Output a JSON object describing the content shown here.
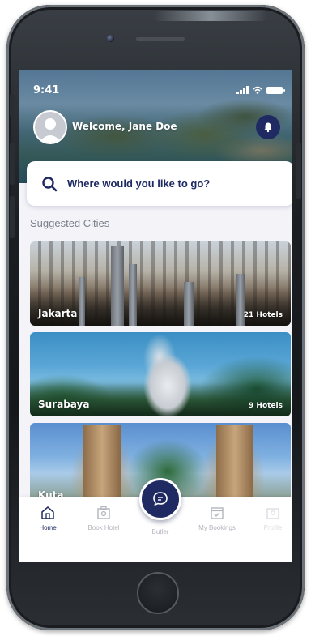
{
  "status_bar": {
    "time": "9:41"
  },
  "header": {
    "welcome_text": "Welcome, Jane Doe",
    "avatar_icon": "user-avatar-icon",
    "bell_icon": "bell-icon"
  },
  "search": {
    "placeholder": "Where would you like to go?"
  },
  "suggested": {
    "title": "Suggested Cities",
    "cities": [
      {
        "name": "Jakarta",
        "hotels": "21 Hotels"
      },
      {
        "name": "Surabaya",
        "hotels": "9 Hotels"
      },
      {
        "name": "Kuta",
        "hotels": ""
      }
    ]
  },
  "nav": {
    "items": [
      {
        "label": "Home",
        "icon": "home-icon"
      },
      {
        "label": "Book Hotel",
        "icon": "hotel-icon"
      },
      {
        "label": "Butler",
        "icon": "chat-icon"
      },
      {
        "label": "My Bookings",
        "icon": "calendar-check-icon"
      },
      {
        "label": "Profile",
        "icon": "profile-icon"
      }
    ]
  },
  "colors": {
    "primary": "#1f2a63",
    "inactive": "#b2b5bd",
    "background": "#f3f3f8"
  }
}
